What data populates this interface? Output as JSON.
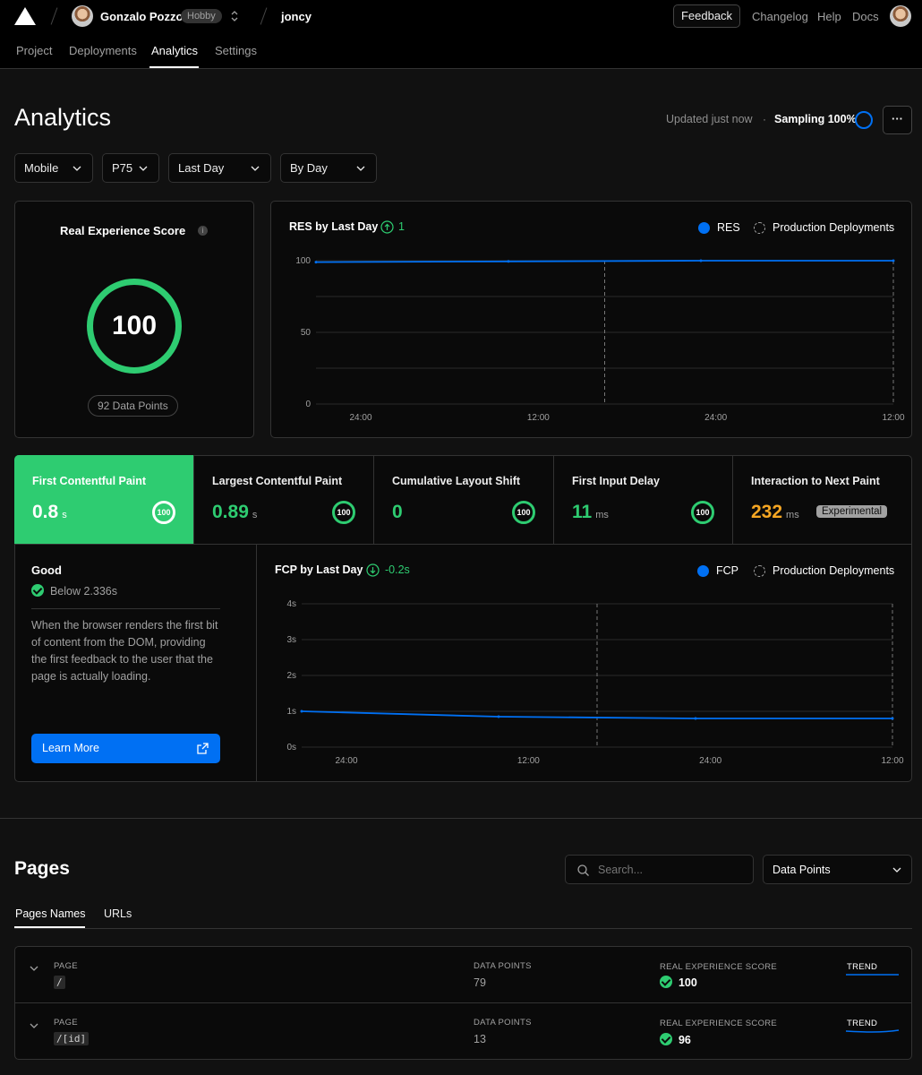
{
  "header": {
    "user_name": "Gonzalo Pozzo",
    "plan_badge": "Hobby",
    "project_name": "joncy",
    "feedback_label": "Feedback",
    "links": [
      "Changelog",
      "Help",
      "Docs"
    ],
    "tabs": [
      "Project",
      "Deployments",
      "Analytics",
      "Settings"
    ],
    "active_tab": "Analytics"
  },
  "page": {
    "title": "Analytics",
    "updated": "Updated just now",
    "sampling": "Sampling 100%",
    "more_label": "···"
  },
  "filters": [
    "Mobile",
    "P75",
    "Last Day",
    "By Day"
  ],
  "res_card": {
    "title": "Real Experience Score",
    "score": "100",
    "data_points": "92 Data Points"
  },
  "res_chart": {
    "title": "RES by Last Day",
    "delta": "1",
    "legend": [
      "RES",
      "Production Deployments"
    ]
  },
  "metrics": [
    {
      "title": "First Contentful Paint",
      "value": "0.8",
      "unit": "s",
      "score": "100",
      "active": true
    },
    {
      "title": "Largest Contentful Paint",
      "value": "0.89",
      "unit": "s",
      "score": "100"
    },
    {
      "title": "Cumulative Layout Shift",
      "value": "0",
      "unit": "",
      "score": "100"
    },
    {
      "title": "First Input Delay",
      "value": "11",
      "unit": "ms",
      "score": "100"
    },
    {
      "title": "Interaction to Next Paint",
      "value": "232",
      "unit": "ms",
      "badge": "Experimental"
    }
  ],
  "detail": {
    "status": "Good",
    "threshold": "Below 2.336s",
    "description": "When the browser renders the first bit of content from the DOM, providing the first feedback to the user that the page is actually loading.",
    "learn_more": "Learn More"
  },
  "fcp_chart": {
    "title": "FCP by Last Day",
    "delta": "-0.2s",
    "legend": [
      "FCP",
      "Production Deployments"
    ]
  },
  "pages": {
    "title": "Pages",
    "search_placeholder": "Search...",
    "sort": "Data Points",
    "tabs": [
      "Pages Names",
      "URLs"
    ],
    "col_page": "PAGE",
    "col_points": "DATA POINTS",
    "col_score": "REAL EXPERIENCE SCORE",
    "col_trend": "TREND",
    "rows": [
      {
        "page": "/",
        "points": "79",
        "score": "100"
      },
      {
        "page": "/[id]",
        "points": "13",
        "score": "96"
      }
    ]
  },
  "colors": {
    "accent": "#0070f3",
    "good": "#2ecc71",
    "warn": "#f5a623"
  },
  "chart_data": [
    {
      "type": "line",
      "title": "RES by Last Day",
      "x": [
        "24:00",
        "12:00",
        "24:00",
        "12:00"
      ],
      "series": [
        {
          "name": "RES",
          "values": [
            99,
            99.5,
            100,
            100
          ]
        }
      ],
      "yticks": [
        "0",
        "50",
        "100"
      ],
      "ylim": [
        0,
        100
      ]
    },
    {
      "type": "line",
      "title": "FCP by Last Day",
      "x": [
        "24:00",
        "12:00",
        "24:00",
        "12:00"
      ],
      "series": [
        {
          "name": "FCP",
          "values": [
            1.0,
            0.85,
            0.8,
            0.8
          ]
        }
      ],
      "yticks": [
        "0s",
        "1s",
        "2s",
        "3s",
        "4s"
      ],
      "ylim": [
        0,
        4
      ]
    }
  ]
}
